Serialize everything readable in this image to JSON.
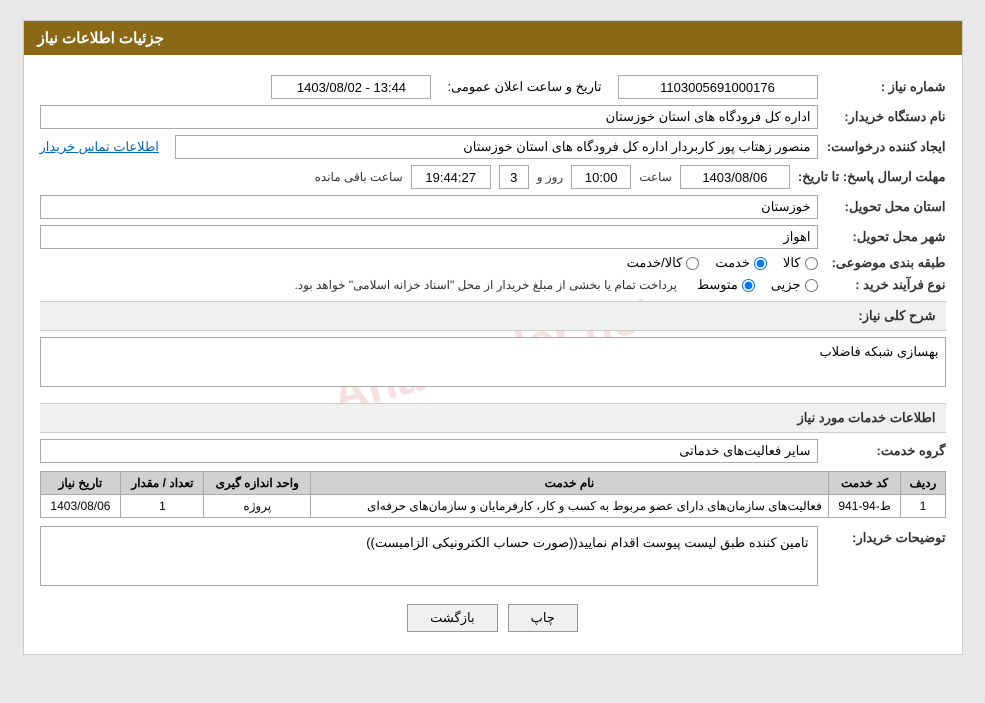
{
  "header": {
    "title": "جزئیات اطلاعات نیاز"
  },
  "fields": {
    "need_number_label": "شماره نیاز :",
    "need_number_value": "1103005691000176",
    "announce_date_label": "تاریخ و ساعت اعلان عمومی:",
    "announce_date_value": "1403/08/02 - 13:44",
    "buyer_org_label": "نام دستگاه خریدار:",
    "buyer_org_value": "اداره کل فرودگاه های استان خوزستان",
    "creator_label": "ایجاد کننده درخواست:",
    "creator_value": "منصور زهتاب پور کاربردار اداره کل فرودگاه های استان خوزستان",
    "contact_link": "اطلاعات تماس خریدار",
    "deadline_label": "مهلت ارسال پاسخ: تا تاریخ:",
    "deadline_date": "1403/08/06",
    "deadline_time_label": "ساعت",
    "deadline_time": "10:00",
    "deadline_day_label": "روز و",
    "deadline_days": "3",
    "deadline_remaining_label": "ساعت باقی مانده",
    "deadline_remaining": "19:44:27",
    "province_label": "استان محل تحویل:",
    "province_value": "خوزستان",
    "city_label": "شهر محل تحویل:",
    "city_value": "اهواز",
    "category_label": "طبقه بندی موضوعی:",
    "category_options": [
      "کالا",
      "خدمت",
      "کالا/خدمت"
    ],
    "category_selected": "خدمت",
    "purchase_type_label": "نوع فرآیند خرید :",
    "purchase_type_options": [
      "جزیی",
      "متوسط"
    ],
    "purchase_type_selected": "متوسط",
    "purchase_type_note": "پرداخت تمام یا بخشی از مبلغ خریدار از محل \"اسناد خزانه اسلامی\" خواهد بود.",
    "need_desc_label": "شرح کلی نیاز:",
    "need_desc_value": "بهسازی شبکه فاضلاب",
    "services_section_label": "اطلاعات خدمات مورد نیاز",
    "service_group_label": "گروه خدمت:",
    "service_group_value": "سایر فعالیت‌های خدماتی",
    "table": {
      "headers": [
        "ردیف",
        "کد خدمت",
        "نام خدمت",
        "واحد اندازه گیری",
        "تعداد / مقدار",
        "تاریخ نیاز"
      ],
      "rows": [
        {
          "row": "1",
          "code": "ط-94-941",
          "name": "فعالیت‌های سازمان‌های دارای عضو مربوط به کسب و کار، کارفرمایان و سازمان‌های حرفه‌ای",
          "unit": "پروژه",
          "count": "1",
          "date": "1403/08/06"
        }
      ]
    },
    "buyer_desc_label": "توضیحات خریدار:",
    "buyer_desc_value": "تامین کننده طبق لیست پیوست اقدام نمایید((صورت حساب الکترونیکی الزامیست))"
  },
  "buttons": {
    "print_label": "چاپ",
    "back_label": "بازگشت"
  }
}
